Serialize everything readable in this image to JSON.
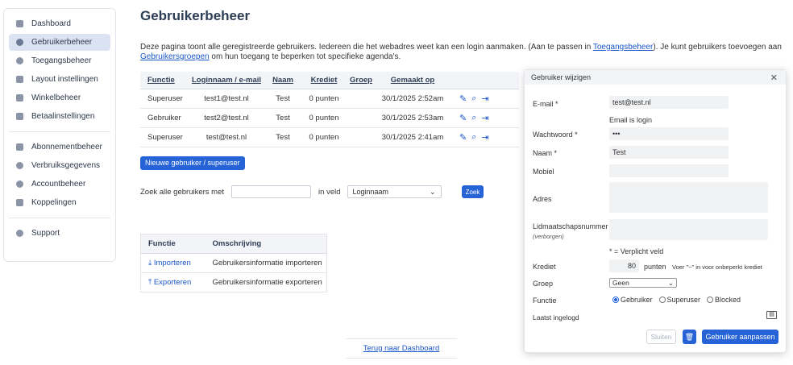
{
  "sidebar": {
    "items": [
      {
        "label": "Dashboard",
        "icon": "dashboard-icon"
      },
      {
        "label": "Gebruikerbeheer",
        "icon": "users-icon",
        "active": true
      },
      {
        "label": "Toegangsbeheer",
        "icon": "key-icon"
      },
      {
        "label": "Layout instellingen",
        "icon": "shield-icon"
      },
      {
        "label": "Winkelbeheer",
        "icon": "store-icon"
      },
      {
        "label": "Betaalinstellingen",
        "icon": "card-icon"
      },
      {
        "label": "Abonnementbeheer",
        "icon": "checkbox-icon"
      },
      {
        "label": "Verbruiksgegevens",
        "icon": "pie-icon"
      },
      {
        "label": "Accountbeheer",
        "icon": "at-icon"
      },
      {
        "label": "Koppelingen",
        "icon": "arrows-icon"
      },
      {
        "label": "Support",
        "icon": "help-icon"
      }
    ]
  },
  "page": {
    "title": "Gebruikerbeheer",
    "intro_part1": "Deze pagina toont alle geregistreerde gebruikers. Iedereen die het webadres weet kan een login aanmaken. (Aan te passen in ",
    "intro_link1": "Toegangsbeheer",
    "intro_part2": "). Je kunt gebruikers toevoegen aan ",
    "intro_link2": "Gebruikersgroepen",
    "intro_part3": " om hun toegang te beperken tot specifieke agenda's."
  },
  "users_table": {
    "headers": [
      "Functie",
      "Loginnaam / e-mail",
      "Naam",
      "Krediet",
      "Groep",
      "Gemaakt op"
    ],
    "rows": [
      {
        "functie": "Superuser",
        "login": "test1@test.nl",
        "naam": "Test",
        "krediet": "0 punten",
        "groep": "",
        "gemaakt": "30/1/2025 2:52am"
      },
      {
        "functie": "Gebruiker",
        "login": "test2@test.nl",
        "naam": "Test",
        "krediet": "0 punten",
        "groep": "",
        "gemaakt": "30/1/2025 2:53am"
      },
      {
        "functie": "Superuser",
        "login": "test@test.nl",
        "naam": "Test",
        "krediet": "0 punten",
        "groep": "",
        "gemaakt": "30/1/2025 2:41am"
      }
    ]
  },
  "new_user_button": "Nieuwe gebruiker / superuser",
  "search": {
    "label": "Zoek alle gebruikers met",
    "in_field_label": "in veld",
    "field_value": "Loginnaam",
    "button": "Zoek"
  },
  "io_table": {
    "headers": [
      "Functie",
      "Omschrijving"
    ],
    "rows": [
      {
        "functie": "Importeren",
        "omschrijving": "Gebruikersinformatie importeren",
        "icon": "download-icon"
      },
      {
        "functie": "Exporteren",
        "omschrijving": "Gebruikersinformatie exporteren",
        "icon": "upload-icon"
      }
    ]
  },
  "back_link": "Terug naar Dashboard",
  "modal": {
    "title": "Gebruiker wijzigen",
    "email_label": "E-mail *",
    "email_value": "test@test.nl",
    "email_note": "Email is login",
    "password_label": "Wachtwoord *",
    "password_value": "•••",
    "name_label": "Naam *",
    "name_value": "Test",
    "mobile_label": "Mobiel",
    "address_label": "Adres",
    "member_label": "Lidmaatschapsnummer",
    "member_sub": "(verborgen)",
    "required_note": "* = Verplicht veld",
    "credit_label": "Krediet",
    "credit_value": "80",
    "credit_unit": "punten",
    "credit_hint": "Voer \"~\" in voor onbeperkt krediet",
    "group_label": "Groep",
    "group_value": "Geen",
    "function_label": "Functie",
    "function_options": [
      "Gebruiker",
      "Superuser",
      "Blocked"
    ],
    "function_selected": "Gebruiker",
    "last_login_label": "Laatst ingelogd",
    "close_button": "Sluiten",
    "save_button": "Gebruiker aanpassen"
  }
}
